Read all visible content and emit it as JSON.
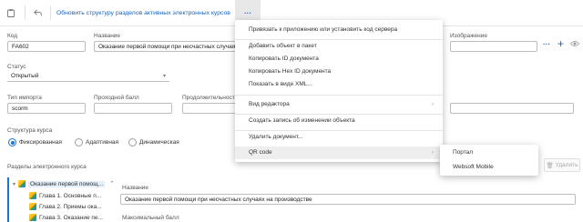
{
  "toolbar": {
    "action_label": "Обновить структуру разделов активных электронных курсов",
    "more_label": "···"
  },
  "form": {
    "code_label": "Код",
    "code_value": "FA602",
    "name_label": "Название",
    "name_value": "Оказание первой помощи при несчастных случаях",
    "image_label": "Изображение",
    "status_label": "Статус",
    "status_value": "Открытый",
    "import_type_label": "Тип импорта",
    "import_type_value": "scorm",
    "pass_score_label": "Проходной балл",
    "duration_label": "Продолжительность",
    "structure_label": "Структура курса",
    "structure_options": [
      "Фиксированная",
      "Адаптивная",
      "Динамическая"
    ],
    "structure_selected": 0,
    "sections_label": "Разделы электронного курса",
    "delete_label": "Удалить",
    "section_name_label": "Название",
    "section_name_value": "Оказание первой помощи при несчастных случаях на производстве",
    "max_score_label": "Максимальный балл"
  },
  "tree": {
    "root": "Оказание первой помощ...",
    "children": [
      "Глава 1. Основные п...",
      "Глава 2. Приемы ока...",
      "Глава 3. Оказание пе..."
    ]
  },
  "menu": {
    "items": [
      "Привязать к приложению или установить код сервера",
      "Добавить объект в пакет",
      "Копировать ID документа",
      "Копировать Hex ID документа",
      "Показать в виде XML...",
      "Вид редактора",
      "Создать запись об изменении объекта",
      "Удалить документ...",
      "QR code"
    ]
  },
  "submenu": {
    "items": [
      "Портал",
      "Websoft Mobile"
    ]
  },
  "colors": {
    "accent": "#1976d2",
    "link": "#1565c0"
  }
}
